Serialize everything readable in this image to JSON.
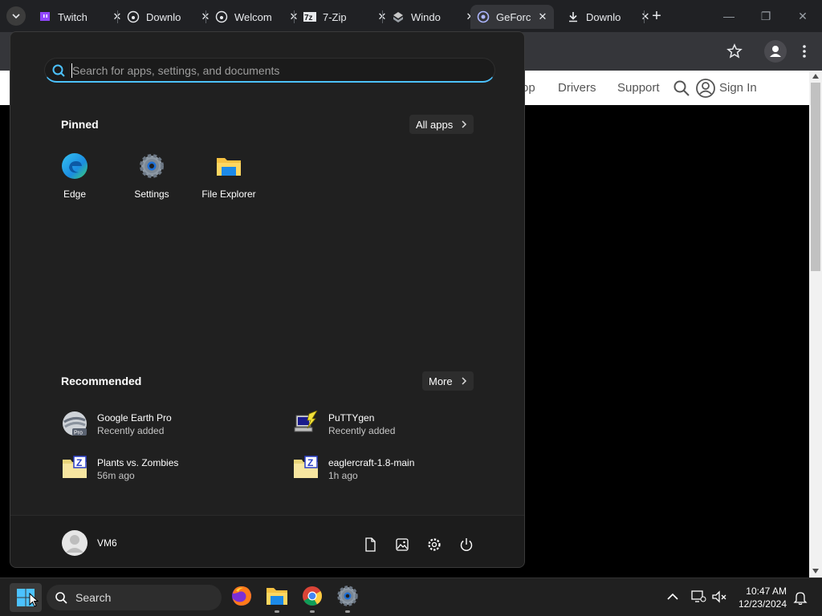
{
  "browser": {
    "tabs": [
      {
        "title": "Twitch",
        "icon": "twitch-icon"
      },
      {
        "title": "Downlo",
        "icon": "github-icon"
      },
      {
        "title": "Welcom",
        "icon": "github-icon"
      },
      {
        "title": "7-Zip",
        "icon": "7zip-icon"
      },
      {
        "title": "Windo",
        "icon": "windows-icon"
      },
      {
        "title": "GeForc",
        "icon": "geforce-icon",
        "active": true
      },
      {
        "title": "Downlo",
        "icon": "download-icon"
      }
    ],
    "new_tab_symbol": "+",
    "close_symbol": "✕",
    "window_controls": {
      "minimize": "—",
      "restore": "❐",
      "close": "✕"
    }
  },
  "website": {
    "nav_items": [
      "op",
      "Drivers",
      "Support"
    ],
    "sign_in": "Sign In"
  },
  "start_menu": {
    "search_placeholder": "Search for apps, settings, and documents",
    "pinned_title": "Pinned",
    "all_apps_label": "All apps",
    "pinned": [
      {
        "label": "Edge",
        "icon": "edge-icon"
      },
      {
        "label": "Settings",
        "icon": "settings-icon"
      },
      {
        "label": "File Explorer",
        "icon": "file-explorer-icon"
      }
    ],
    "recommended_title": "Recommended",
    "more_label": "More",
    "recommended": [
      {
        "name": "Google Earth Pro",
        "sub": "Recently added",
        "icon": "google-earth-pro-icon"
      },
      {
        "name": "PuTTYgen",
        "sub": "Recently added",
        "icon": "puttygen-icon"
      },
      {
        "name": "Plants vs. Zombies",
        "sub": "56m ago",
        "icon": "zip-folder-icon"
      },
      {
        "name": "eaglercraft-1.8-main",
        "sub": "1h ago",
        "icon": "zip-folder-icon"
      }
    ],
    "user_name": "VM6",
    "footer_icons": [
      "documents-icon",
      "pictures-icon",
      "settings-icon",
      "power-icon"
    ]
  },
  "taskbar": {
    "search_placeholder": "Search",
    "apps": [
      "firefox-icon",
      "file-explorer-icon",
      "chrome-icon",
      "settings-icon"
    ],
    "time": "10:47 AM",
    "date": "12/23/2024"
  },
  "colors": {
    "accent": "#4cc2ff",
    "start_bg": "#202020",
    "taskbar_bg": "#202020",
    "tab_strip": "#202124"
  }
}
